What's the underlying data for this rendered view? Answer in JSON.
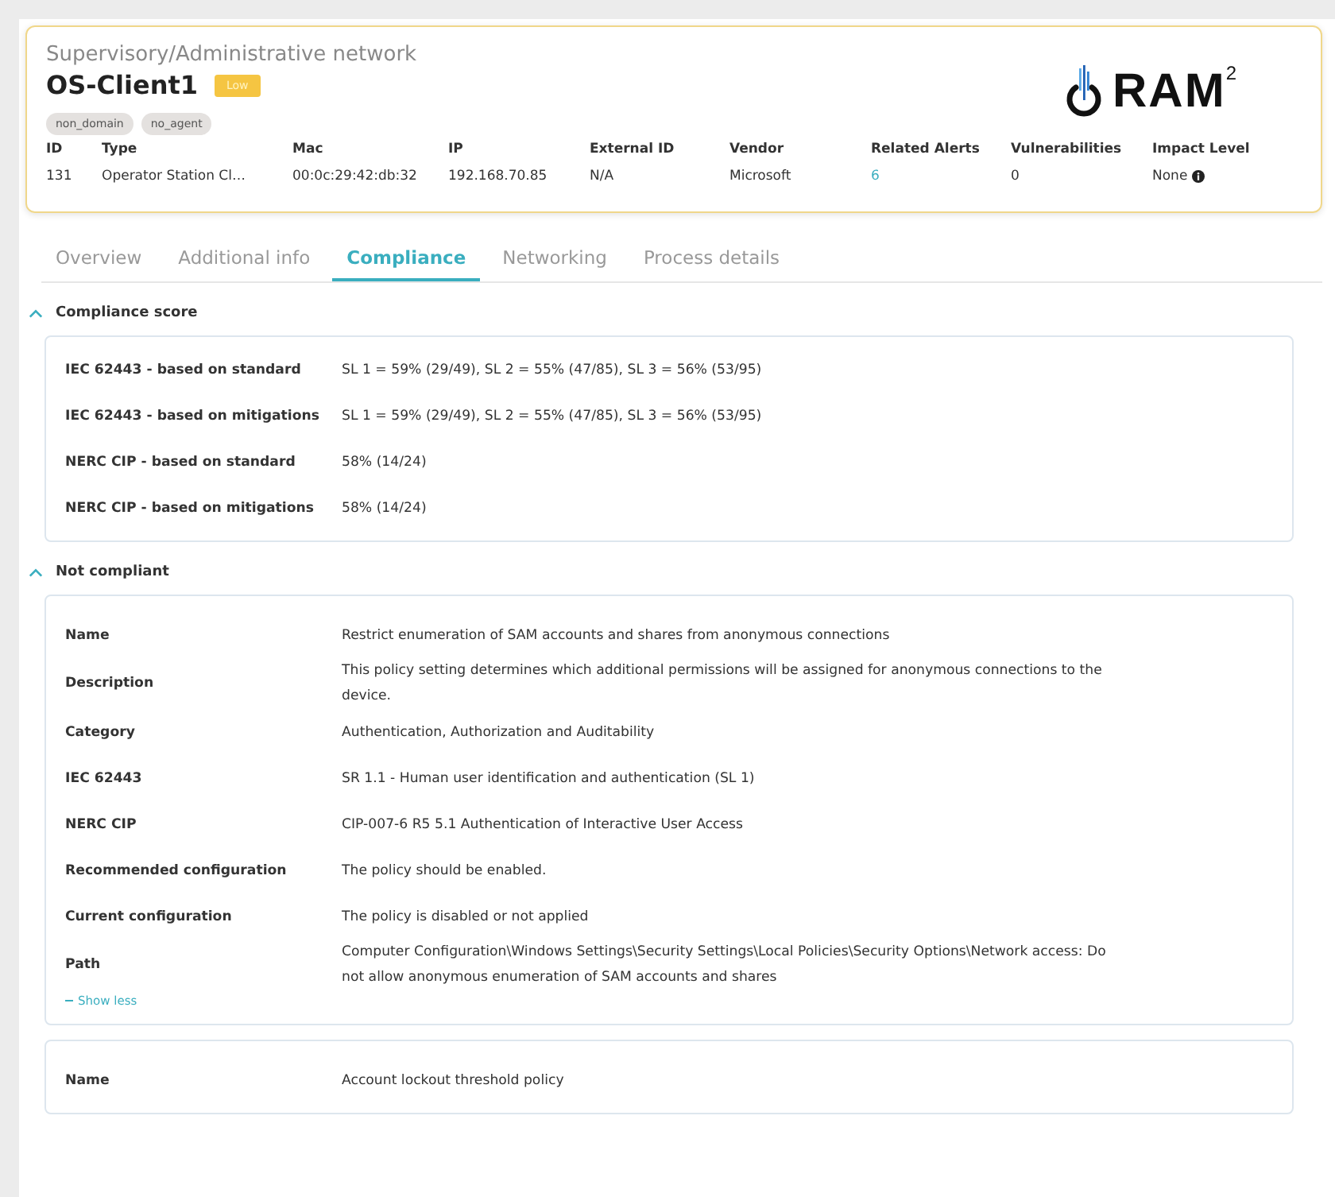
{
  "device": {
    "network": "Supervisory/Administrative network",
    "name": "OS-Client1",
    "severity": "Low",
    "tags": [
      "non_domain",
      "no_agent"
    ],
    "fields": [
      {
        "label": "ID",
        "value": "131",
        "kind": "text"
      },
      {
        "label": "Type",
        "value": "Operator Station Cl…",
        "kind": "text"
      },
      {
        "label": "Mac",
        "value": "00:0c:29:42:db:32",
        "kind": "text"
      },
      {
        "label": "IP",
        "value": "192.168.70.85",
        "kind": "text"
      },
      {
        "label": "External ID",
        "value": "N/A",
        "kind": "text"
      },
      {
        "label": "Vendor",
        "value": "Microsoft",
        "kind": "text"
      },
      {
        "label": "Related Alerts",
        "value": "6",
        "kind": "link"
      },
      {
        "label": "Vulnerabilities",
        "value": "0",
        "kind": "text"
      },
      {
        "label": "Impact Level",
        "value": "None",
        "kind": "info"
      }
    ]
  },
  "logo": {
    "text": "RAM",
    "superscript": "2"
  },
  "tabs": [
    {
      "label": "Overview",
      "selected": false
    },
    {
      "label": "Additional info",
      "selected": false
    },
    {
      "label": "Compliance",
      "selected": true
    },
    {
      "label": "Networking",
      "selected": false
    },
    {
      "label": "Process details",
      "selected": false
    }
  ],
  "compliance_score": {
    "title": "Compliance score",
    "expanded": true,
    "rows": [
      {
        "label": "IEC 62443 - based on standard",
        "value": "SL 1 = 59% (29/49), SL 2 = 55% (47/85), SL 3 = 56% (53/95)"
      },
      {
        "label": "IEC 62443 - based on mitigations",
        "value": "SL 1 = 59% (29/49), SL 2 = 55% (47/85), SL 3 = 56% (53/95)"
      },
      {
        "label": "NERC CIP - based on standard",
        "value": "58% (14/24)"
      },
      {
        "label": "NERC CIP - based on mitigations",
        "value": "58% (14/24)"
      }
    ]
  },
  "not_compliant": {
    "title": "Not compliant",
    "expanded": true,
    "items": [
      {
        "rows": [
          {
            "label": "Name",
            "value": "Restrict enumeration of SAM accounts and shares from anonymous connections"
          },
          {
            "label": "Description",
            "value": "This policy setting determines which additional permissions will be assigned for anonymous connections to the device."
          },
          {
            "label": "Category",
            "value": "Authentication, Authorization and Auditability"
          },
          {
            "label": "IEC 62443",
            "value": "SR 1.1 - Human user identification and authentication (SL 1)"
          },
          {
            "label": "NERC CIP",
            "value": "CIP-007-6 R5 5.1 Authentication of Interactive User Access"
          },
          {
            "label": "Recommended configuration",
            "value": "The policy should be enabled."
          },
          {
            "label": "Current configuration",
            "value": "The policy is disabled or not applied"
          },
          {
            "label": "Path",
            "value": "Computer Configuration\\Windows Settings\\Security Settings\\Local Policies\\Security Options\\Network access: Do not allow anonymous enumeration of SAM accounts and shares"
          }
        ],
        "toggle": "Show less"
      },
      {
        "rows": [
          {
            "label": "Name",
            "value": "Account lockout threshold policy"
          }
        ]
      }
    ]
  }
}
